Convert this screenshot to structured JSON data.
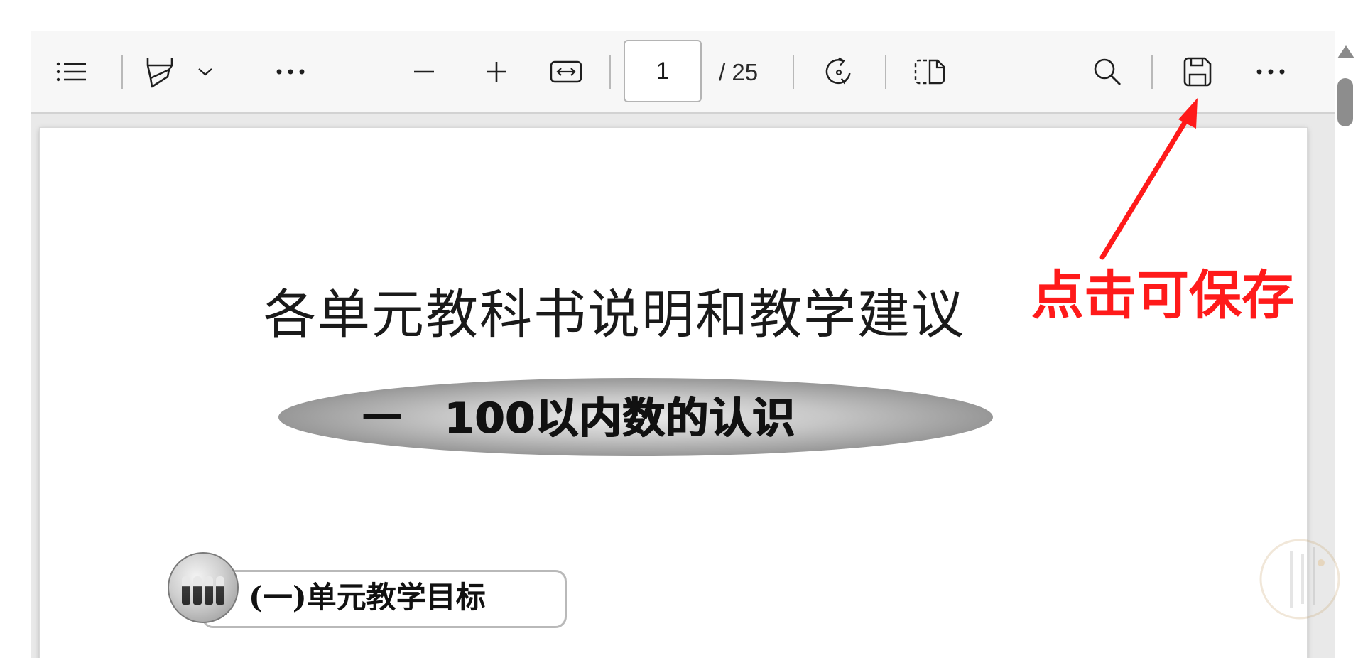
{
  "toolbar": {
    "contents_icon": "list-icon",
    "highlight_icon": "highlighter-icon",
    "dropdown_icon": "chevron-down-icon",
    "more_left_icon": "more-horizontal-icon",
    "zoom_out_icon": "minus-icon",
    "zoom_in_icon": "plus-icon",
    "fit_width_icon": "fit-width-icon",
    "page_current": "1",
    "page_total": "/ 25",
    "rotate_icon": "rotate-icon",
    "page_view_icon": "two-page-icon",
    "search_icon": "search-icon",
    "save_icon": "save-icon",
    "more_right_icon": "more-horizontal-icon"
  },
  "document": {
    "title": "各单元教科书说明和教学建议",
    "chapter_number": "一",
    "chapter_title": "100以内数的认识",
    "section_title": "(一)单元教学目标"
  },
  "annotation": {
    "text": "点击可保存",
    "color": "#ff1a1a"
  },
  "scrollbar": {
    "up_icon": "arrow-up-icon"
  }
}
